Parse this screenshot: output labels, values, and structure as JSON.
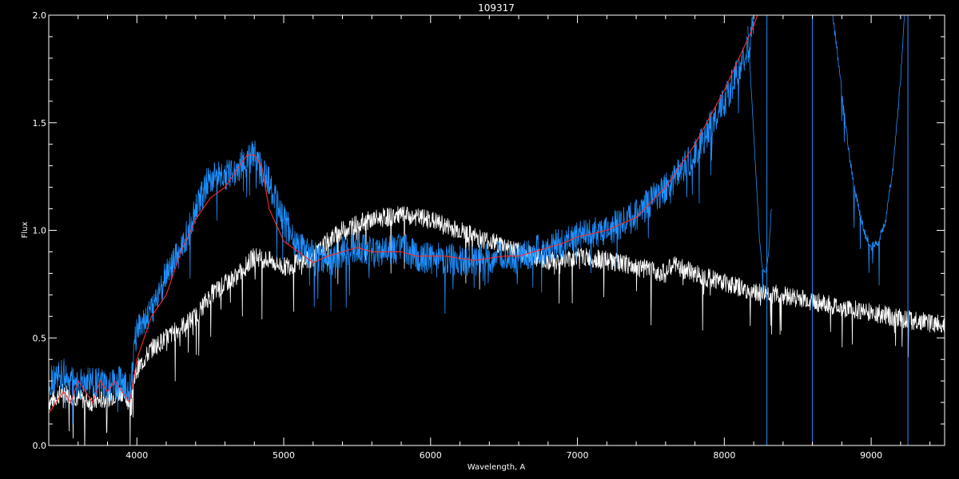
{
  "chart_data": {
    "type": "line",
    "title": "109317",
    "xlabel": "Wavelength, A",
    "ylabel": "Flux",
    "xlim": [
      3400,
      9500
    ],
    "ylim": [
      0.0,
      2.0
    ],
    "x_ticks": [
      4000,
      5000,
      6000,
      7000,
      8000,
      9000
    ],
    "y_ticks": [
      0.0,
      0.5,
      1.0,
      1.5,
      2.0
    ],
    "y_tick_labels": [
      "0.0",
      "0.5",
      "1.0",
      "1.5",
      "2.0"
    ],
    "background": "#000000",
    "axis_color": "#ffffff",
    "series": [
      {
        "color": "#ffffff",
        "noise": 0.045,
        "x": [
          3400,
          3500,
          3600,
          3700,
          3800,
          3900,
          3950,
          4000,
          4100,
          4200,
          4300,
          4400,
          4500,
          4600,
          4700,
          4800,
          4900,
          5000,
          5100,
          5200,
          5300,
          5400,
          5500,
          5600,
          5700,
          5800,
          5900,
          6000,
          6100,
          6200,
          6300,
          6400,
          6500,
          6600,
          6700,
          6800,
          6900,
          7000,
          7200,
          7400,
          7600,
          7650,
          7800,
          8000,
          8200,
          8400,
          8600,
          8800,
          9000,
          9200,
          9400,
          9500
        ],
        "y": [
          0.2,
          0.25,
          0.22,
          0.2,
          0.22,
          0.25,
          0.2,
          0.35,
          0.45,
          0.5,
          0.55,
          0.6,
          0.7,
          0.75,
          0.8,
          0.88,
          0.86,
          0.83,
          0.85,
          0.87,
          0.95,
          1.0,
          1.03,
          1.05,
          1.06,
          1.07,
          1.06,
          1.05,
          1.02,
          1.0,
          0.97,
          0.95,
          0.93,
          0.9,
          0.88,
          0.86,
          0.86,
          0.88,
          0.86,
          0.83,
          0.8,
          0.84,
          0.8,
          0.76,
          0.71,
          0.7,
          0.67,
          0.64,
          0.62,
          0.59,
          0.57,
          0.56
        ]
      },
      {
        "color": "#1e90ff",
        "noise": 0.075,
        "x": [
          3400,
          3500,
          3600,
          3700,
          3800,
          3900,
          3950,
          4000,
          4100,
          4200,
          4300,
          4400,
          4500,
          4600,
          4700,
          4800,
          4900,
          5000,
          5100,
          5200,
          5300,
          5400,
          5500,
          5600,
          5700,
          5800,
          5900,
          6000,
          6100,
          6200,
          6300,
          6400,
          6500,
          6600,
          6700,
          6800,
          6900,
          7000,
          7200,
          7400,
          7600,
          7800,
          8000,
          8100,
          8150,
          8200
        ],
        "y": [
          0.3,
          0.33,
          0.28,
          0.3,
          0.27,
          0.3,
          0.25,
          0.55,
          0.62,
          0.8,
          0.9,
          1.1,
          1.25,
          1.25,
          1.3,
          1.35,
          1.22,
          1.05,
          0.92,
          0.88,
          0.85,
          0.9,
          0.92,
          0.9,
          0.9,
          0.92,
          0.88,
          0.87,
          0.87,
          0.86,
          0.86,
          0.87,
          0.88,
          0.87,
          0.9,
          0.92,
          0.94,
          0.97,
          1.0,
          1.07,
          1.2,
          1.35,
          1.6,
          1.75,
          1.82,
          1.95
        ]
      },
      {
        "color": "#1e90ff",
        "noise": 0.008,
        "x": [
          8160,
          8180,
          8200,
          8220,
          8240,
          8260,
          8280,
          8300,
          8320
        ],
        "y": [
          1.95,
          1.7,
          1.45,
          1.2,
          0.95,
          0.82,
          0.8,
          0.88,
          1.1
        ]
      },
      {
        "color": "#1e90ff",
        "noise": 0.02,
        "x": [
          8730,
          8800,
          8850,
          8900,
          8950,
          9000,
          9050,
          9100,
          9150,
          9200,
          9230
        ],
        "y": [
          2.05,
          1.65,
          1.35,
          1.15,
          1.0,
          0.92,
          0.95,
          1.05,
          1.3,
          1.7,
          2.05
        ]
      },
      {
        "color": "#ff2a2a",
        "noise": 0.0,
        "x": [
          3400,
          3450,
          3500,
          3550,
          3600,
          3650,
          3700,
          3750,
          3800,
          3850,
          3900,
          3950,
          4000,
          4100,
          4200,
          4300,
          4400,
          4500,
          4600,
          4700,
          4750,
          4800,
          4850,
          4900,
          5000,
          5100,
          5200,
          5300,
          5400,
          5500,
          5600,
          5700,
          5800,
          5900,
          6000,
          6100,
          6200,
          6300,
          6400,
          6500,
          6600,
          6700,
          6800,
          6900,
          7000,
          7200,
          7400,
          7600,
          7800,
          8000,
          8100,
          8200,
          8250
        ],
        "y": [
          0.15,
          0.2,
          0.25,
          0.2,
          0.3,
          0.25,
          0.2,
          0.3,
          0.25,
          0.3,
          0.25,
          0.2,
          0.4,
          0.6,
          0.7,
          0.9,
          1.05,
          1.15,
          1.2,
          1.3,
          1.35,
          1.35,
          1.3,
          1.1,
          0.95,
          0.9,
          0.85,
          0.88,
          0.9,
          0.92,
          0.9,
          0.9,
          0.9,
          0.88,
          0.88,
          0.88,
          0.87,
          0.86,
          0.87,
          0.88,
          0.88,
          0.9,
          0.92,
          0.94,
          0.97,
          1.0,
          1.06,
          1.2,
          1.4,
          1.65,
          1.8,
          1.95,
          2.05
        ]
      }
    ],
    "vertical_lines": {
      "color": "#1e90ff",
      "x": [
        8290,
        8600,
        9250
      ]
    }
  }
}
